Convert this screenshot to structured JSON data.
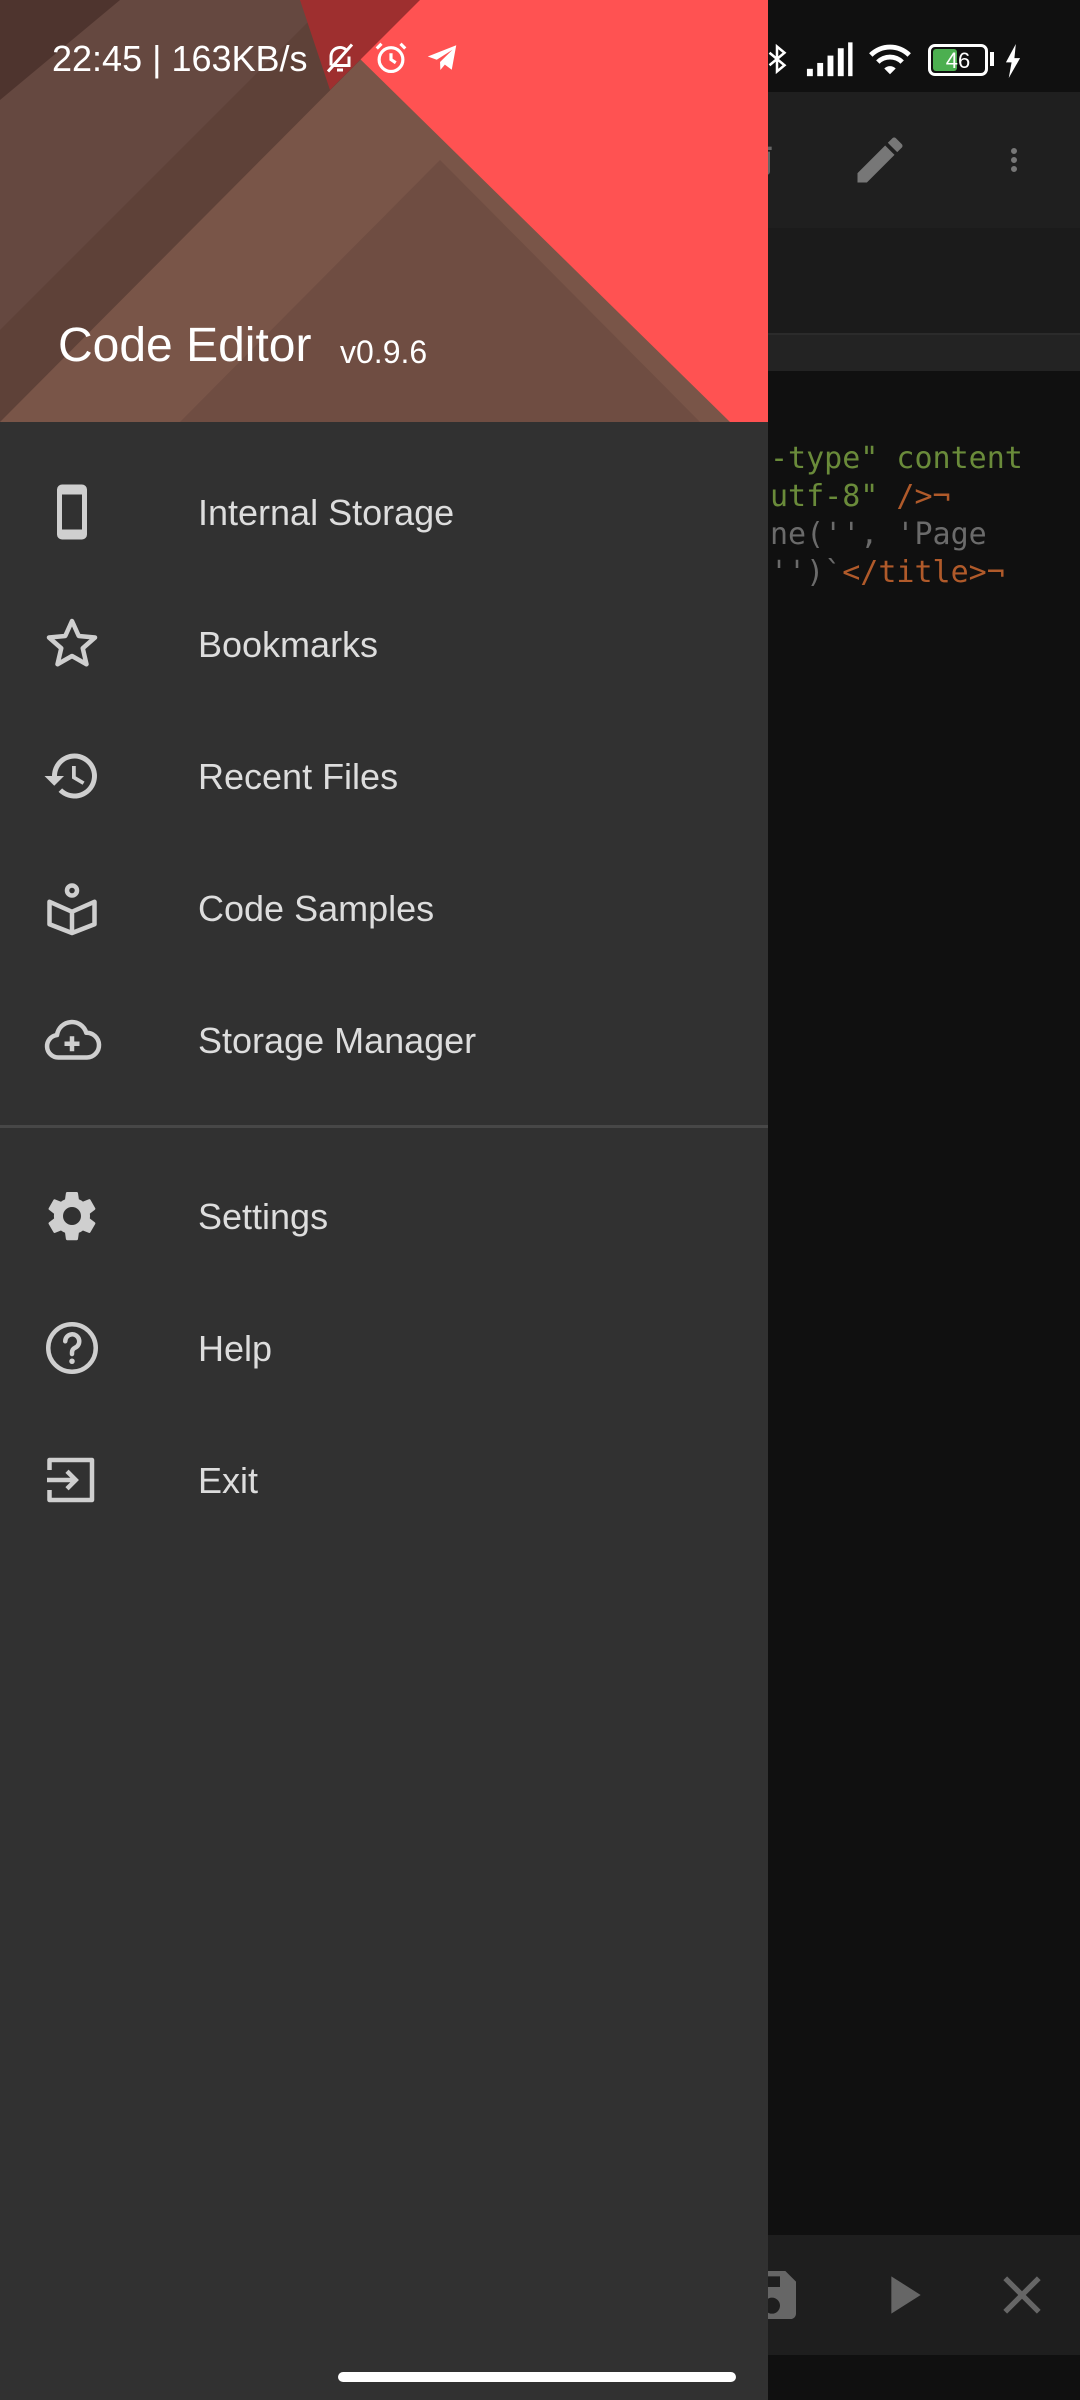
{
  "status_bar": {
    "time_speed": "22:45 | 163KB/s",
    "battery_level": "46",
    "icons": [
      "mute-bell-icon",
      "alarm-icon",
      "telegram-icon",
      "bluetooth-icon",
      "signal-icon",
      "wifi-icon",
      "battery-icon",
      "charging-icon"
    ]
  },
  "drawer": {
    "app_name": "Code Editor",
    "version": "v0.9.6",
    "primary_items": [
      {
        "label": "Internal Storage",
        "icon": "phone-icon"
      },
      {
        "label": "Bookmarks",
        "icon": "star-icon"
      },
      {
        "label": "Recent Files",
        "icon": "history-icon"
      },
      {
        "label": "Code Samples",
        "icon": "book-icon"
      },
      {
        "label": "Storage Manager",
        "icon": "cloud-upload-icon"
      }
    ],
    "secondary_items": [
      {
        "label": "Settings",
        "icon": "gear-icon"
      },
      {
        "label": "Help",
        "icon": "help-icon"
      },
      {
        "label": "Exit",
        "icon": "exit-icon"
      }
    ]
  },
  "editor": {
    "toolbar_icons": [
      "delete-icon",
      "pencil-icon",
      "more-vert-icon"
    ],
    "bottom_icons": [
      "save-icon",
      "play-icon",
      "close-icon"
    ],
    "code_lines": [
      {
        "a": "-type\"",
        "b": " content"
      },
      {
        "a": "utf-8\"",
        "b": " />¬"
      },
      {
        "a": "ne('',",
        "b": " 'Page"
      },
      {
        "a": "'')`",
        "b": "</title>¬"
      }
    ]
  },
  "colors": {
    "drawer_bg": "#313131",
    "header_brown": "#5d4037",
    "header_accent": "#ff5252",
    "status_red": "#9a2f2f",
    "text_primary": "#dddddd"
  }
}
